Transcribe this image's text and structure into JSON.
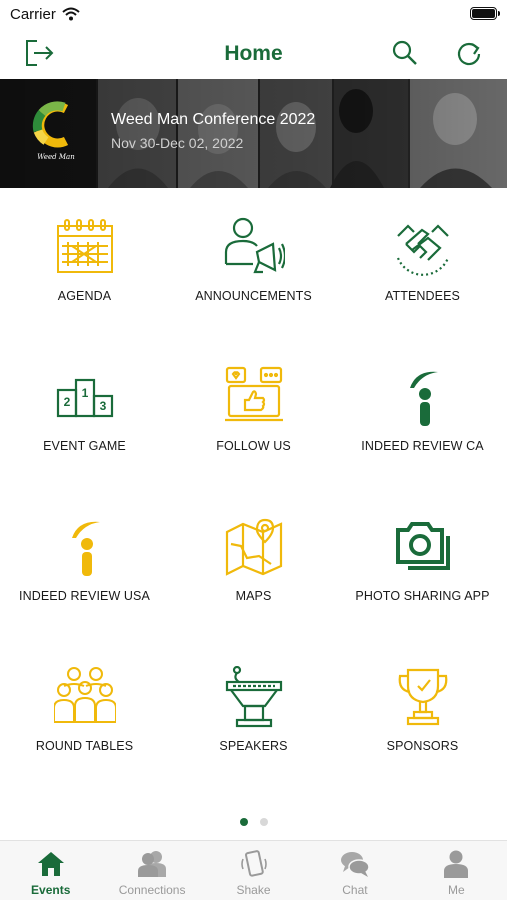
{
  "status_bar": {
    "carrier": "Carrier"
  },
  "nav": {
    "title": "Home"
  },
  "banner": {
    "title": "Weed Man Conference 2022",
    "dates": "Nov 30-Dec 02, 2022",
    "logo_text": "Weed Man"
  },
  "colors": {
    "green": "#1a6b3a",
    "yellow": "#f0b90b",
    "inactive": "#9a9a9a"
  },
  "tiles": [
    {
      "label": "AGENDA",
      "icon": "calendar-icon",
      "color": "yellow"
    },
    {
      "label": "ANNOUNCEMENTS",
      "icon": "megaphone-person-icon",
      "color": "green"
    },
    {
      "label": "ATTENDEES",
      "icon": "handshake-icon",
      "color": "green"
    },
    {
      "label": "EVENT GAME",
      "icon": "podium-icon",
      "color": "green"
    },
    {
      "label": "FOLLOW US",
      "icon": "social-media-icon",
      "color": "yellow"
    },
    {
      "label": "INDEED REVIEW CA",
      "icon": "indeed-icon",
      "color": "green"
    },
    {
      "label": "INDEED REVIEW USA",
      "icon": "indeed-icon",
      "color": "yellow"
    },
    {
      "label": "MAPS",
      "icon": "map-icon",
      "color": "yellow"
    },
    {
      "label": "PHOTO SHARING APP",
      "icon": "camera-icon",
      "color": "green"
    },
    {
      "label": "ROUND TABLES",
      "icon": "group-icon",
      "color": "yellow"
    },
    {
      "label": "SPEAKERS",
      "icon": "lectern-icon",
      "color": "green"
    },
    {
      "label": "SPONSORS",
      "icon": "trophy-icon",
      "color": "yellow"
    }
  ],
  "pagination": {
    "pages": 2,
    "current": 1
  },
  "tab_bar": [
    {
      "label": "Events",
      "icon": "house-icon",
      "active": true
    },
    {
      "label": "Connections",
      "icon": "people-icon",
      "active": false
    },
    {
      "label": "Shake",
      "icon": "phone-shake-icon",
      "active": false
    },
    {
      "label": "Chat",
      "icon": "chat-bubbles-icon",
      "active": false
    },
    {
      "label": "Me",
      "icon": "person-icon",
      "active": false
    }
  ]
}
